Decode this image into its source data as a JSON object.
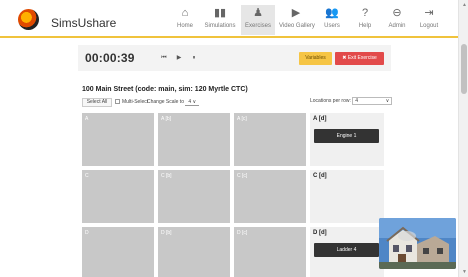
{
  "app": {
    "name": "SimsUshare"
  },
  "nav": [
    {
      "label": "Home",
      "icon": "home-icon",
      "glyph": "⌂"
    },
    {
      "label": "Simulations",
      "icon": "simulations-icon",
      "glyph": "▮▮"
    },
    {
      "label": "Exercises",
      "icon": "exercises-icon",
      "glyph": "♟",
      "active": true
    },
    {
      "label": "Video Gallery",
      "icon": "video-icon",
      "glyph": "▶"
    },
    {
      "label": "Users",
      "icon": "users-icon",
      "glyph": "👥"
    },
    {
      "label": "Help",
      "icon": "help-icon",
      "glyph": "?"
    },
    {
      "label": "Admin",
      "icon": "admin-icon",
      "glyph": "⊖"
    },
    {
      "label": "Logout",
      "icon": "logout-icon",
      "glyph": "⇥"
    }
  ],
  "controls": {
    "timer": "00:00:39",
    "rewind": "⏮",
    "play": "▶",
    "pause": "⏸",
    "variables": "Variables",
    "exit": "✖ Exit Exercise"
  },
  "exercise": {
    "title": "100 Main Street (code: main, sim: 120 Myrtle CTC)",
    "select_all": "Select All",
    "multi_select": "Multi-Select",
    "change_scale": "Change Scale to",
    "scale_value": "4",
    "locations_label": "Locations per row:",
    "locations_value": "4"
  },
  "grid": [
    {
      "label": "A",
      "light": false
    },
    {
      "label": "A [b]",
      "light": false
    },
    {
      "label": "A [c]",
      "light": false
    },
    {
      "label": "A [d]",
      "light": true,
      "unit": "Engine 1"
    },
    {
      "label": "C",
      "light": false
    },
    {
      "label": "C [b]",
      "light": false
    },
    {
      "label": "C [c]",
      "light": false
    },
    {
      "label": "C [d]",
      "light": true
    },
    {
      "label": "D",
      "light": false
    },
    {
      "label": "D [b]",
      "light": false
    },
    {
      "label": "D [c]",
      "light": false
    },
    {
      "label": "D [d]",
      "light": true,
      "unit": "Ladder 4"
    }
  ],
  "colors": {
    "accent": "#f0c33c",
    "variables": "#f6c545",
    "exit": "#e24a4a",
    "cell": "#c8c8c8"
  }
}
